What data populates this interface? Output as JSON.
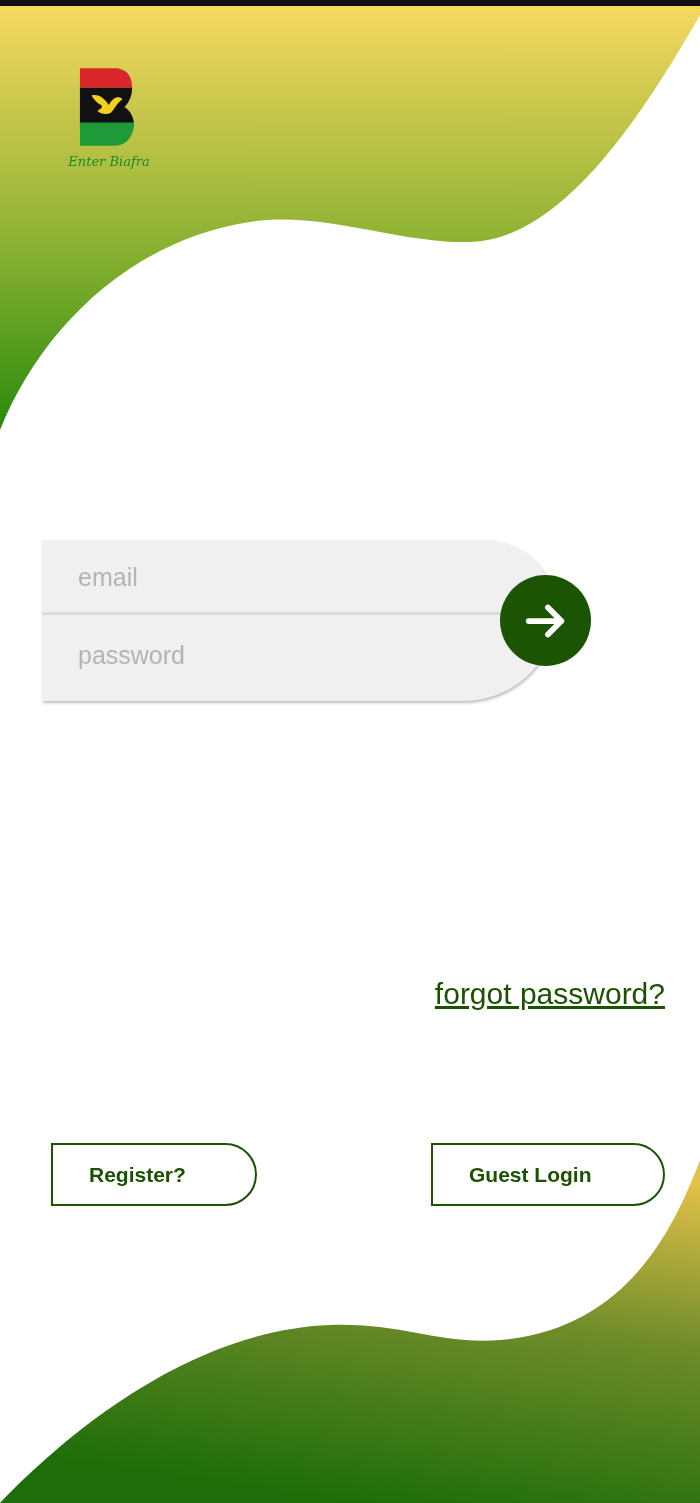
{
  "logo": {
    "caption": "Enter Biafra"
  },
  "login_form": {
    "email": {
      "placeholder": "email"
    },
    "password": {
      "placeholder": "password"
    }
  },
  "forgot_password_link": "forgot password?",
  "buttons": [
    {
      "label": "Register?"
    },
    {
      "label": "Guest Login"
    }
  ]
}
